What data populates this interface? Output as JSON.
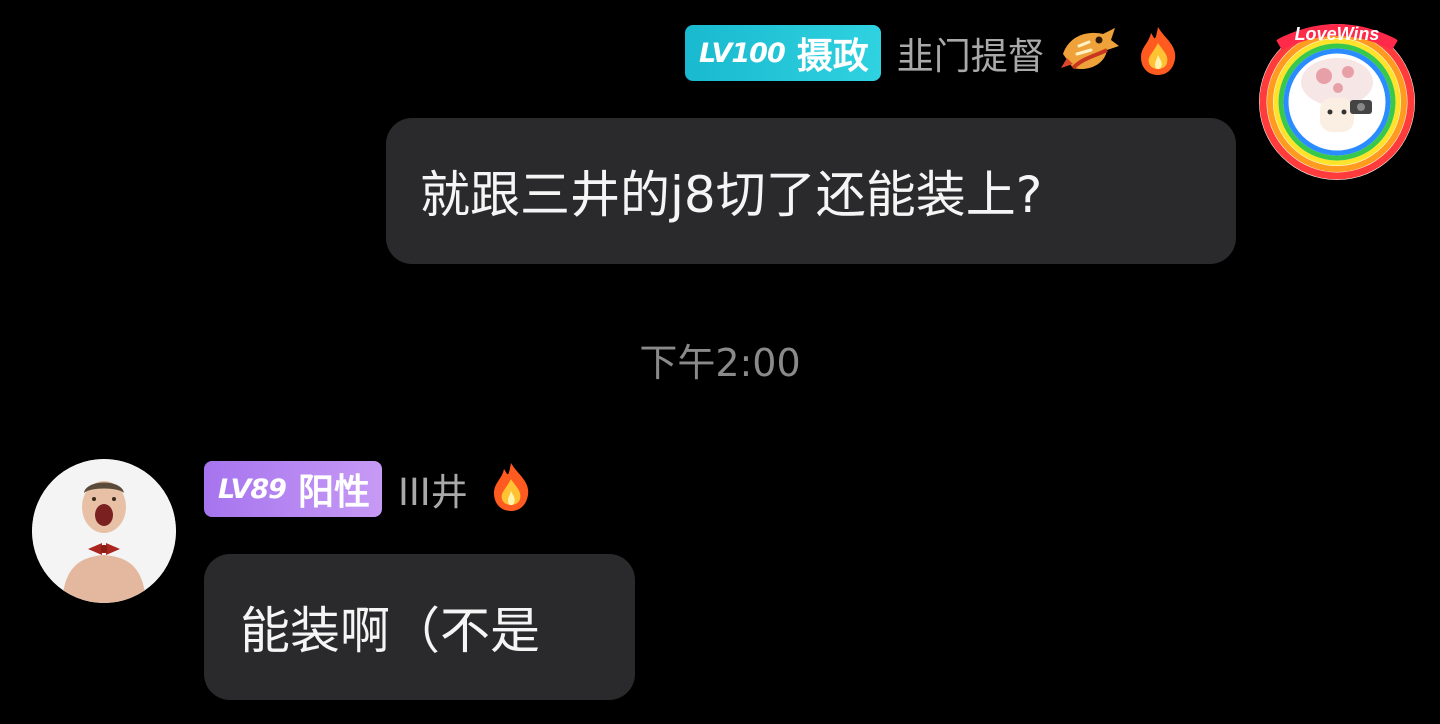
{
  "messages": [
    {
      "side": "right",
      "badge_level": "LV100",
      "badge_title": "摄政",
      "username": "韭门提督",
      "text": "就跟三井的j8切了还能装上?",
      "avatar_text": "LoveWins",
      "icons": [
        "dragon-icon",
        "fire-icon"
      ]
    },
    {
      "side": "left",
      "badge_level": "LV89",
      "badge_title": "阳性",
      "username": "III井",
      "text": "能装啊（不是",
      "icons": [
        "fire-icon"
      ]
    }
  ],
  "timestamp": "下午2:00",
  "colors": {
    "background": "#000000",
    "bubble": "#2a2a2c",
    "badge_cyan": "#1fc3d6",
    "badge_purple": "#b385f2",
    "username": "#a9a9a9",
    "timestamp": "#8a8a8a"
  }
}
